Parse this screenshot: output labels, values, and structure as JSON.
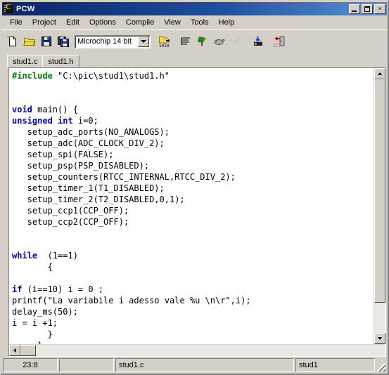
{
  "window": {
    "title": "PCW",
    "icon": "c-chip-icon",
    "buttons": {
      "minimize": "minimize-button",
      "maximize": "maximize-button",
      "close": "×"
    }
  },
  "menu": {
    "items": [
      "File",
      "Project",
      "Edit",
      "Options",
      "Compile",
      "View",
      "Tools",
      "Help"
    ]
  },
  "toolbar": {
    "buttons": [
      {
        "name": "new-file-icon"
      },
      {
        "name": "open-folder-icon"
      },
      {
        "name": "save-icon"
      },
      {
        "name": "save-all-icon"
      }
    ],
    "device_combo": {
      "value": "Microchip 14 bit",
      "arrow": "chevron-down-icon"
    },
    "buttons_right": [
      {
        "name": "compile-binary-icon"
      },
      {
        "name": "list-file-icon"
      },
      {
        "name": "project-tree-icon"
      },
      {
        "name": "debug-icon"
      },
      {
        "name": "statistics-chart-icon"
      },
      {
        "name": "program-chip-icon"
      },
      {
        "name": "exit-door-icon"
      }
    ]
  },
  "tabs": [
    {
      "label": "stud1.c",
      "active": true
    },
    {
      "label": "stud1.h",
      "active": false
    }
  ],
  "editor": {
    "lines": [
      [
        {
          "t": "#include ",
          "c": "pp"
        },
        {
          "t": "\"C:\\pic\\stud1\\stud1.h\"",
          "c": ""
        }
      ],
      [],
      [],
      [
        {
          "t": "void ",
          "c": "kw"
        },
        {
          "t": "main() {",
          "c": ""
        }
      ],
      [
        {
          "t": "unsigned int ",
          "c": "kw"
        },
        {
          "t": "i=0;",
          "c": ""
        }
      ],
      [
        {
          "t": "   setup_adc_ports(NO_ANALOGS);",
          "c": ""
        }
      ],
      [
        {
          "t": "   setup_adc(ADC_CLOCK_DIV_2);",
          "c": ""
        }
      ],
      [
        {
          "t": "   setup_spi(FALSE);",
          "c": ""
        }
      ],
      [
        {
          "t": "   setup_psp(PSP_DISABLED);",
          "c": ""
        }
      ],
      [
        {
          "t": "   setup_counters(RTCC_INTERNAL,RTCC_DIV_2);",
          "c": ""
        }
      ],
      [
        {
          "t": "   setup_timer_1(T1_DISABLED);",
          "c": ""
        }
      ],
      [
        {
          "t": "   setup_timer_2(T2_DISABLED,0,1);",
          "c": ""
        }
      ],
      [
        {
          "t": "   setup_ccp1(CCP_OFF);",
          "c": ""
        }
      ],
      [
        {
          "t": "   setup_ccp2(CCP_OFF);",
          "c": ""
        }
      ],
      [],
      [],
      [
        {
          "t": "while ",
          "c": "kw"
        },
        {
          "t": " (1==1)",
          "c": ""
        }
      ],
      [
        {
          "t": "       {",
          "c": ""
        }
      ],
      [],
      [
        {
          "t": "if ",
          "c": "kw"
        },
        {
          "t": "(i==10) i = 0 ;",
          "c": ""
        }
      ],
      [
        {
          "t": "printf(\"La variabile i adesso vale %u \\n\\r\",i);",
          "c": ""
        }
      ],
      [
        {
          "t": "delay_ms(50);",
          "c": ""
        }
      ],
      [
        {
          "t": "i = i +1;",
          "c": ""
        }
      ],
      [
        {
          "t": "       }",
          "c": ""
        }
      ],
      [
        {
          "t": "     }",
          "c": ""
        }
      ]
    ],
    "colors": {
      "keyword": "#0000d0",
      "preprocessor": "#008000",
      "text": "#000000",
      "background": "#ffffff"
    }
  },
  "statusbar": {
    "cursor_position": "23:8",
    "mode": "",
    "filename": "stud1.c",
    "project": "stud1"
  }
}
